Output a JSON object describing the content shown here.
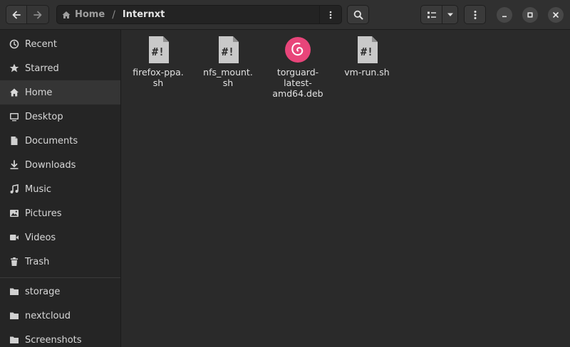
{
  "header": {
    "breadcrumb": {
      "home_label": "Home",
      "separator": "/",
      "current_label": "Internxt"
    },
    "icons": {
      "back": "arrow-left-icon",
      "forward": "arrow-right-icon",
      "path_menu": "vertical-dots-icon",
      "search": "search-icon",
      "view": "list-view-icon",
      "view_dropdown": "chevron-down-icon",
      "menu": "vertical-dots-icon",
      "minimize": "minimize-icon",
      "maximize": "maximize-icon",
      "close": "close-icon"
    }
  },
  "sidebar": {
    "items": [
      {
        "label": "Recent",
        "icon": "clock-icon",
        "active": false
      },
      {
        "label": "Starred",
        "icon": "star-icon",
        "active": false
      },
      {
        "label": "Home",
        "icon": "home-icon",
        "active": true
      },
      {
        "label": "Desktop",
        "icon": "desktop-icon",
        "active": false
      },
      {
        "label": "Documents",
        "icon": "document-icon",
        "active": false
      },
      {
        "label": "Downloads",
        "icon": "download-icon",
        "active": false
      },
      {
        "label": "Music",
        "icon": "music-icon",
        "active": false
      },
      {
        "label": "Pictures",
        "icon": "picture-icon",
        "active": false
      },
      {
        "label": "Videos",
        "icon": "video-icon",
        "active": false
      },
      {
        "label": "Trash",
        "icon": "trash-icon",
        "active": false
      }
    ],
    "bookmarks": [
      {
        "label": "storage",
        "icon": "folder-icon"
      },
      {
        "label": "nextcloud",
        "icon": "folder-icon"
      },
      {
        "label": "Screenshots",
        "icon": "folder-icon"
      }
    ]
  },
  "files": [
    {
      "name": "firefox-ppa.\nsh",
      "icon": "script-icon",
      "icon_text": "#!"
    },
    {
      "name": "nfs_mount.\nsh",
      "icon": "script-icon",
      "icon_text": "#!"
    },
    {
      "name": "torguard-\nlatest-\namd64.deb",
      "icon": "debian-package-icon",
      "icon_text": ""
    },
    {
      "name": "vm-run.sh",
      "icon": "script-icon",
      "icon_text": "#!"
    }
  ],
  "colors": {
    "debian_accent": "#e8457a",
    "script_icon": "#c9c9c9"
  }
}
